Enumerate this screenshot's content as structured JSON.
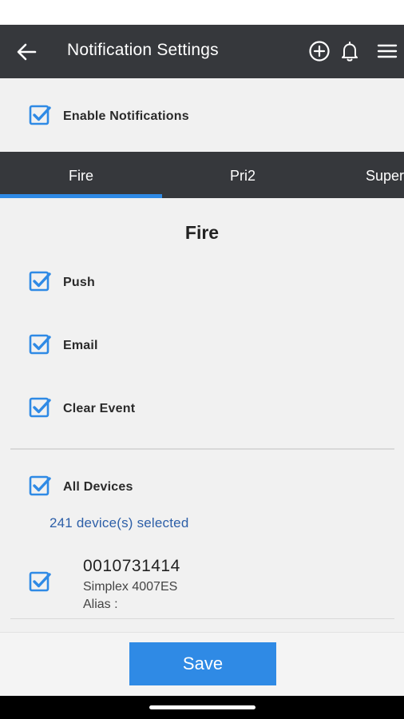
{
  "app_bar": {
    "title": "Notification Settings",
    "back_icon": "arrow-left-icon",
    "actions": [
      "plus-circle-icon",
      "bell-icon",
      "hamburger-menu-icon"
    ]
  },
  "enable_notifications": {
    "label": "Enable Notifications",
    "checked": true
  },
  "tabs": [
    {
      "label": "Fire",
      "selected": true
    },
    {
      "label": "Pri2",
      "selected": false
    },
    {
      "label": "Super",
      "selected": false
    }
  ],
  "section": {
    "title": "Fire",
    "options": [
      {
        "label": "Push",
        "checked": true
      },
      {
        "label": "Email",
        "checked": true
      },
      {
        "label": "Clear Event",
        "checked": true
      }
    ]
  },
  "devices": {
    "all_label": "All Devices",
    "all_checked": true,
    "selected_count_text": "241 device(s) selected",
    "items": [
      {
        "id": "0010731414",
        "model": "Simplex 4007ES",
        "alias": "Alias :",
        "checked": true
      }
    ]
  },
  "save_label": "Save",
  "colors": {
    "accent": "#2f8ae5",
    "app_bar": "#36383c",
    "background": "#f1f1f1",
    "link_text": "#2d5fa8"
  }
}
